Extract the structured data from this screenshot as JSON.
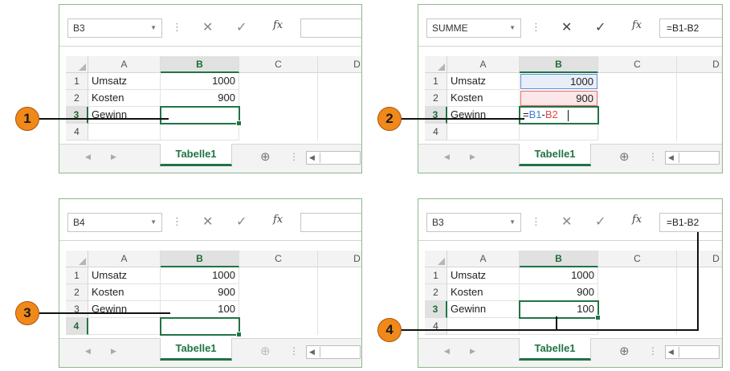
{
  "columns": [
    "A",
    "B",
    "C",
    "D"
  ],
  "rows": [
    "1",
    "2",
    "3",
    "4"
  ],
  "sheet_tab": "Tabelle1",
  "fx_label": "fx",
  "panels": [
    {
      "name_box": "B3",
      "formula": "",
      "cells": {
        "A1": "Umsatz",
        "A2": "Kosten",
        "A3": "Gewinn",
        "B1": "1000",
        "B2": "900",
        "B3": ""
      }
    },
    {
      "name_box": "SUMME",
      "formula": "=B1-B2",
      "cells": {
        "A1": "Umsatz",
        "A2": "Kosten",
        "A3": "Gewinn",
        "B1": "1000",
        "B2": "900",
        "B3": "=B1-B2"
      },
      "edit_parts": {
        "eq": "=",
        "ref1": "B1",
        "minus": "-",
        "ref2": "B2"
      }
    },
    {
      "name_box": "B4",
      "formula": "",
      "cells": {
        "A1": "Umsatz",
        "A2": "Kosten",
        "A3": "Gewinn",
        "B1": "1000",
        "B2": "900",
        "B3": "100"
      }
    },
    {
      "name_box": "B3",
      "formula": "=B1-B2",
      "cells": {
        "A1": "Umsatz",
        "A2": "Kosten",
        "A3": "Gewinn",
        "B1": "1000",
        "B2": "900",
        "B3": "100"
      }
    }
  ],
  "callouts": [
    "1",
    "2",
    "3",
    "4"
  ],
  "colors": {
    "excel_green": "#217346",
    "callout_orange": "#f0891a",
    "ref_blue": "#3c7fd9",
    "ref_red": "#e04848"
  },
  "icons": [
    "dropdown-arrow-icon",
    "cancel-x-icon",
    "enter-check-icon",
    "insert-function-icon",
    "add-sheet-icon",
    "scroll-left-icon",
    "scroll-right-icon"
  ]
}
